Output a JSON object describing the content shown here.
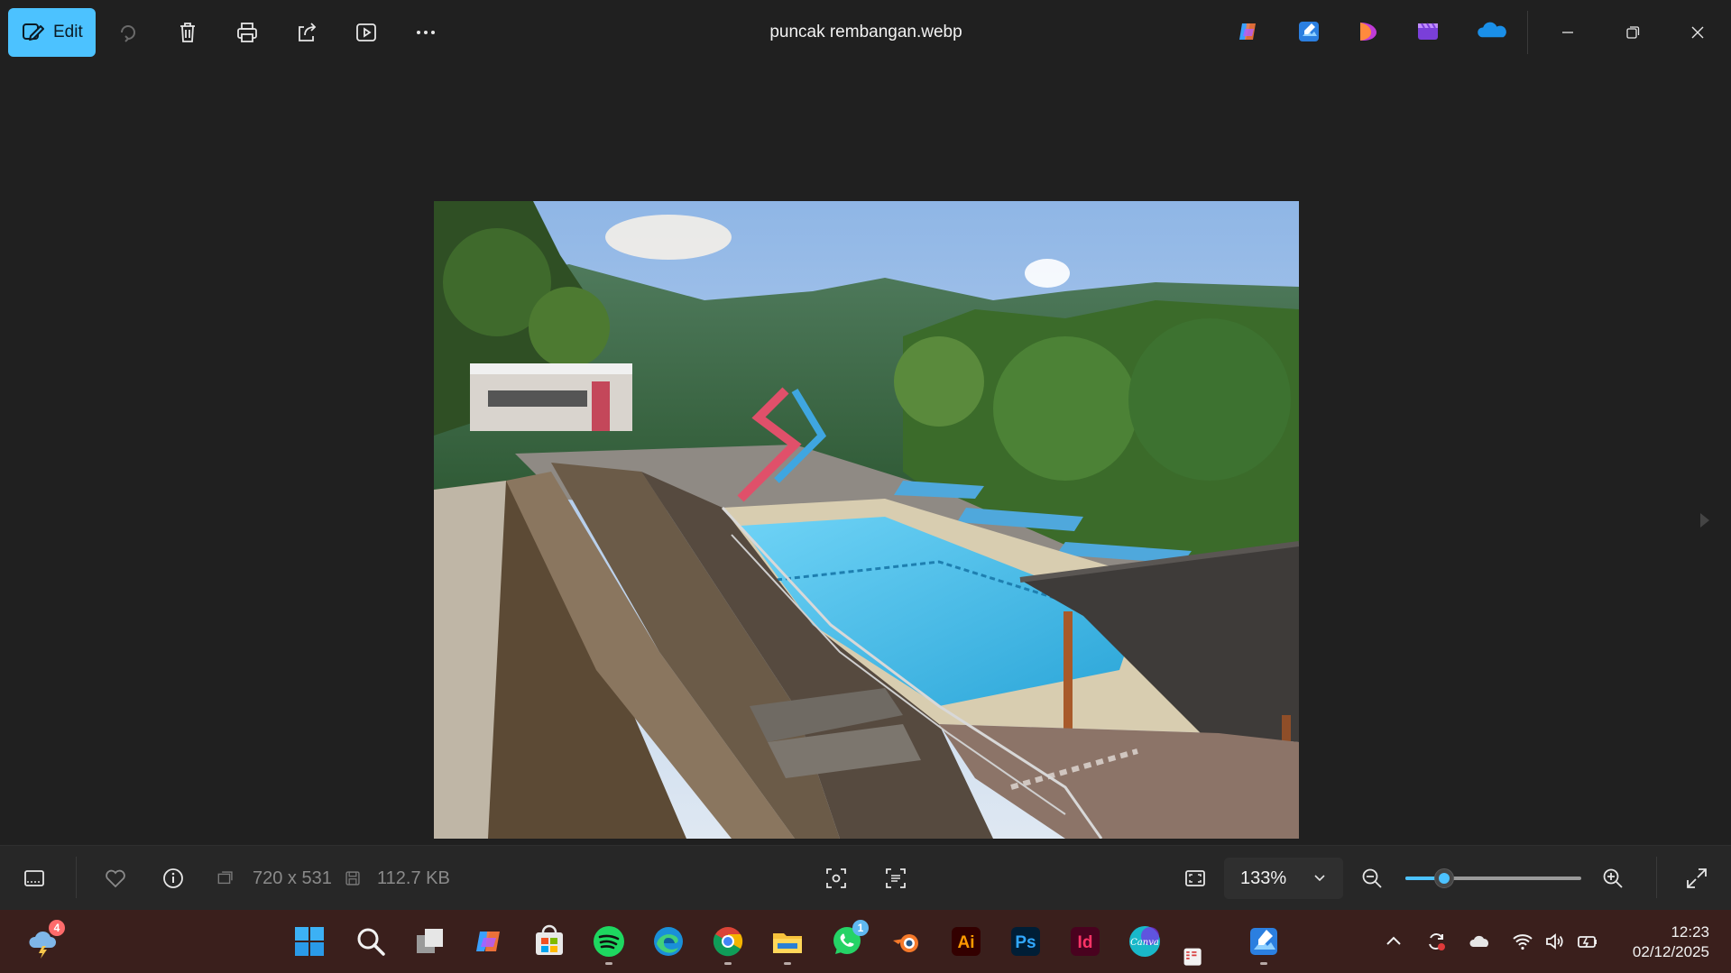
{
  "toolbar": {
    "edit_label": "Edit",
    "file_title": "puncak rembangan.webp",
    "icons": [
      "edit-icon",
      "rotate-icon",
      "delete-icon",
      "print-icon",
      "share-icon",
      "slideshow-icon",
      "more-icon"
    ],
    "apps": [
      "copilot-icon",
      "photos-editor-icon",
      "designer-icon",
      "clipchamp-icon",
      "onedrive-icon"
    ]
  },
  "window_controls": [
    "minimize",
    "restore",
    "close"
  ],
  "status": {
    "dimensions": "720 x 531",
    "file_size": "112.7 KB",
    "zoom_label": "133%",
    "zoom_fraction": 0.22
  },
  "taskbar": {
    "weather_badge": "4",
    "whatsapp_badge": "1",
    "apps": [
      {
        "name": "weather"
      },
      {
        "name": "start"
      },
      {
        "name": "search"
      },
      {
        "name": "task-view"
      },
      {
        "name": "copilot"
      },
      {
        "name": "store"
      },
      {
        "name": "spotify"
      },
      {
        "name": "edge"
      },
      {
        "name": "chrome"
      },
      {
        "name": "file-explorer"
      },
      {
        "name": "whatsapp"
      },
      {
        "name": "blender"
      },
      {
        "name": "illustrator"
      },
      {
        "name": "photoshop"
      },
      {
        "name": "indesign"
      },
      {
        "name": "canva"
      },
      {
        "name": "photos"
      }
    ],
    "illustrator_text": "Ai",
    "photoshop_text": "Ps",
    "indesign_text": "Id",
    "canva_text": "Canva"
  },
  "clock": {
    "time": "12:23",
    "date": "02/12/2025"
  },
  "colors": {
    "accent": "#4cc2ff",
    "background": "#202020",
    "taskbar": "#3a1f1c"
  }
}
